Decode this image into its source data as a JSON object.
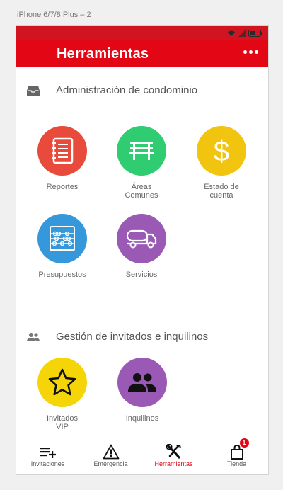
{
  "frame_label": "iPhone 6/7/8 Plus – 2",
  "app_bar": {
    "title": "Herramientas"
  },
  "sections": [
    {
      "title": "Administración de condominio",
      "icon": "inbox-tray-icon",
      "items": [
        {
          "label": "Reportes",
          "icon": "notebook-icon",
          "color": "#e84b3c"
        },
        {
          "label": "Áreas\nComunes",
          "icon": "bench-icon",
          "color": "#2fcc71"
        },
        {
          "label": "Estado de\ncuenta",
          "icon": "dollar-icon",
          "color": "#f1c40f"
        },
        {
          "label": "Presupuestos",
          "icon": "abacus-icon",
          "color": "#3598db"
        },
        {
          "label": "Servicios",
          "icon": "tanker-truck-icon",
          "color": "#9b59b6"
        }
      ]
    },
    {
      "title": "Gestión de invitados e inquilinos",
      "icon": "people-icon",
      "items": [
        {
          "label": "Invitados\nVIP",
          "icon": "star-icon",
          "color": "#f5d508"
        },
        {
          "label": "Inquilinos",
          "icon": "group-icon",
          "color": "#9b59b6"
        }
      ]
    }
  ],
  "tabs": [
    {
      "label": "Invitaciones",
      "icon": "add-list-icon",
      "active": false
    },
    {
      "label": "Emergencia",
      "icon": "warning-icon",
      "active": false
    },
    {
      "label": "Herramientas",
      "icon": "tools-icon",
      "active": true
    },
    {
      "label": "Tienda",
      "icon": "shopping-bag-icon",
      "active": false,
      "badge": "1"
    }
  ],
  "colors": {
    "primary": "#e30614",
    "status_bar": "#d01520",
    "text": "#555555"
  }
}
